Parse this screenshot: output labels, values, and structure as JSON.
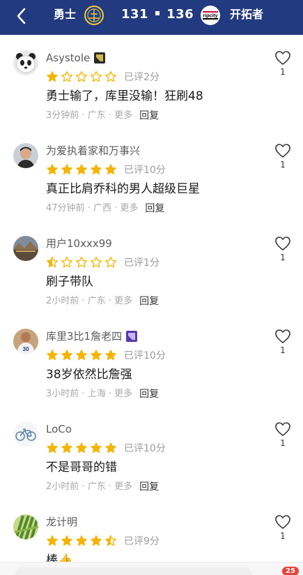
{
  "header": {
    "home_team": "勇士",
    "home_logo_icon": "warriors-logo-icon",
    "score": "131 ▪ 136",
    "score_home": "131",
    "score_away": "136",
    "away_logo_icon": "ripcity-logo-icon",
    "away_logo_text": "ripcity",
    "away_team": "开拓者",
    "background": "#223a80"
  },
  "comments": [
    {
      "username": "Asystole",
      "avatar_icon": "panda-avatar-icon",
      "badge_icon": "team-badge-icon",
      "rating": 1,
      "rating_text": "已评2分",
      "text": "勇士输了，库里没输！狂刷48",
      "time": "3分钟前",
      "location": "广东",
      "more": "更多",
      "reply": "回复",
      "likes": "1"
    },
    {
      "username": "为爱执着家和万事兴",
      "avatar_icon": "person-avatar-icon",
      "badge_icon": "",
      "rating": 5,
      "rating_text": "已评10分",
      "text": "真正比肩乔科的男人超级巨星",
      "time": "47分钟前",
      "location": "广西",
      "more": "更多",
      "reply": "回复",
      "likes": "1"
    },
    {
      "username": "用户10xxx99",
      "avatar_icon": "landscape-avatar-icon",
      "badge_icon": "",
      "rating": 0.5,
      "rating_text": "已评1分",
      "text": "刷子带队",
      "time": "2小时前",
      "location": "广东",
      "more": "更多",
      "reply": "回复",
      "likes": "1"
    },
    {
      "username": "库里3比1詹老四",
      "avatar_icon": "player-avatar-icon",
      "badge_icon": "team-badge-purple-icon",
      "rating": 5,
      "rating_text": "已评10分",
      "text": "38岁依然比詹强",
      "time": "3小时前",
      "location": "上海",
      "more": "更多",
      "reply": "回复",
      "likes": "1"
    },
    {
      "username": "LoCo",
      "avatar_icon": "bicycle-avatar-icon",
      "badge_icon": "",
      "rating": 5,
      "rating_text": "已评10分",
      "text": "不是哥哥的错",
      "time": "2小时前",
      "location": "广东",
      "more": "更多",
      "reply": "回复",
      "likes": "1"
    },
    {
      "username": "龙计明",
      "avatar_icon": "leaves-avatar-icon",
      "badge_icon": "",
      "rating": 4.5,
      "rating_text": "已评9分",
      "text": "棒👍",
      "time": "",
      "location": "",
      "more": "",
      "reply": "",
      "likes": "1"
    }
  ],
  "bottom_bar": {
    "comment_count": "25"
  },
  "colors": {
    "star": "#f4b400",
    "star_empty": "#f4b400",
    "header_bg": "#223a80",
    "badge_red": "#e8433a"
  }
}
